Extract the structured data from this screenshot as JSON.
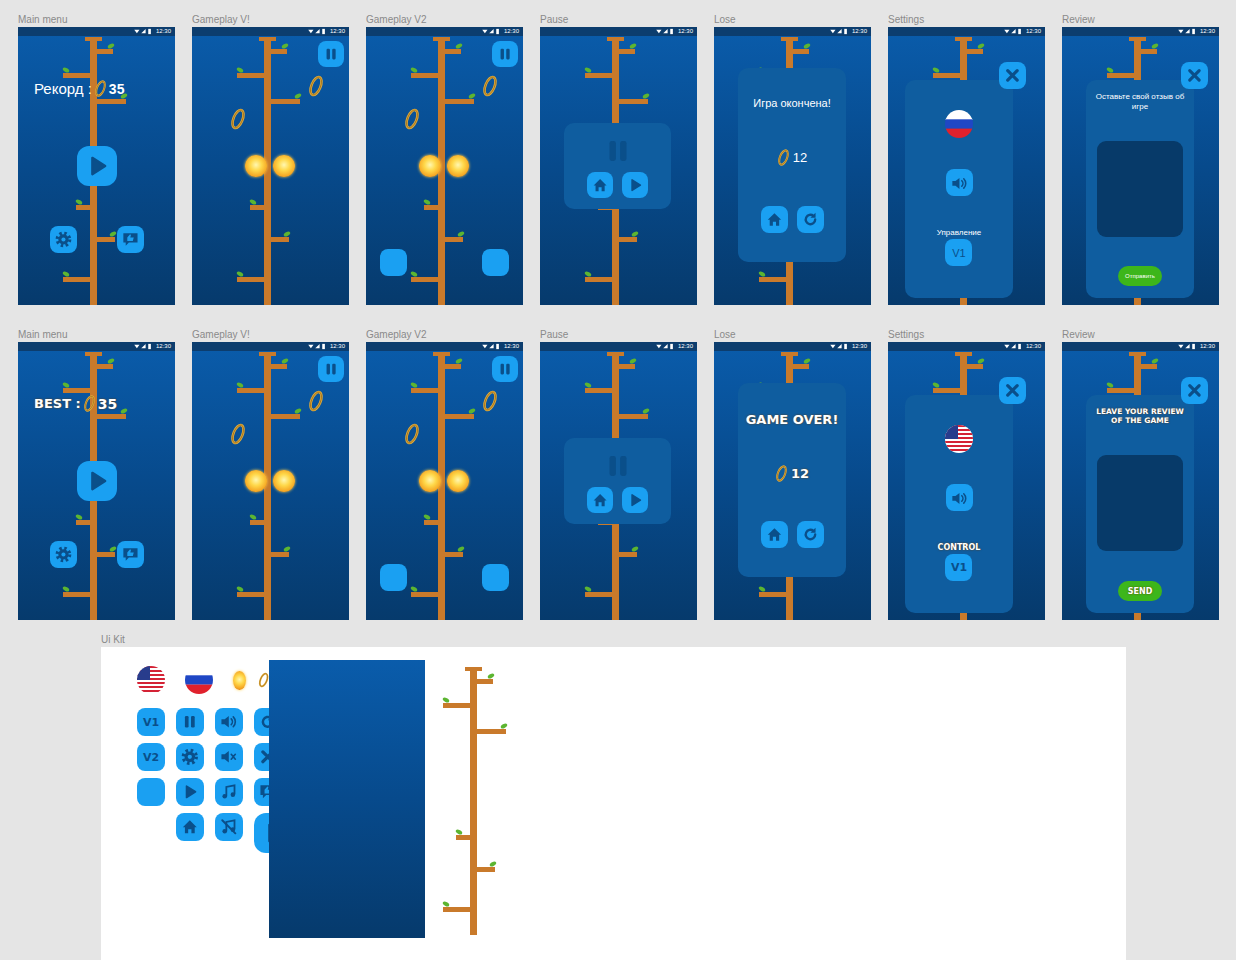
{
  "status_bar": {
    "time": "12:30"
  },
  "rows": [
    {
      "language": "ru",
      "screens": [
        {
          "label": "Main menu",
          "kind": "main_menu",
          "best_label": "Рекорд :",
          "best_value": "35"
        },
        {
          "label": "Gameplay V!",
          "kind": "gameplay",
          "side_buttons": false
        },
        {
          "label": "Gameplay V2",
          "kind": "gameplay",
          "side_buttons": true
        },
        {
          "label": "Pause",
          "kind": "pause"
        },
        {
          "label": "Lose",
          "kind": "lose",
          "title": "Игра окончена!",
          "score": "12"
        },
        {
          "label": "Settings",
          "kind": "settings",
          "control_label": "Управление",
          "control_value": "V1"
        },
        {
          "label": "Review",
          "kind": "review",
          "title": "Оставьте свой отзыв об игре",
          "send": "Отправить"
        }
      ]
    },
    {
      "language": "en",
      "screens": [
        {
          "label": "Main menu",
          "kind": "main_menu",
          "best_label": "BEST :",
          "best_value": "35"
        },
        {
          "label": "Gameplay V!",
          "kind": "gameplay",
          "side_buttons": false
        },
        {
          "label": "Gameplay V2",
          "kind": "gameplay",
          "side_buttons": true
        },
        {
          "label": "Pause",
          "kind": "pause"
        },
        {
          "label": "Lose",
          "kind": "lose",
          "title": "GAME OVER!",
          "score": "12"
        },
        {
          "label": "Settings",
          "kind": "settings",
          "control_label": "CONTROL",
          "control_value": "V1"
        },
        {
          "label": "Review",
          "kind": "review",
          "title": "LEAVE YOUR REVIEW OF THE GAME",
          "send": "SEND"
        }
      ]
    }
  ],
  "ui_kit": {
    "label": "Ui Kit",
    "buttons": [
      {
        "kind": "text",
        "text": "V1"
      },
      {
        "kind": "pause"
      },
      {
        "kind": "sound"
      },
      {
        "kind": "restart"
      },
      {
        "kind": "text",
        "text": "V2"
      },
      {
        "kind": "gear"
      },
      {
        "kind": "mute"
      },
      {
        "kind": "close"
      },
      {
        "kind": "blank"
      },
      {
        "kind": "play"
      },
      {
        "kind": "music"
      },
      {
        "kind": "review"
      },
      {
        "kind": "home"
      },
      {
        "kind": "music-off"
      },
      {
        "kind": "big-play"
      }
    ]
  }
}
